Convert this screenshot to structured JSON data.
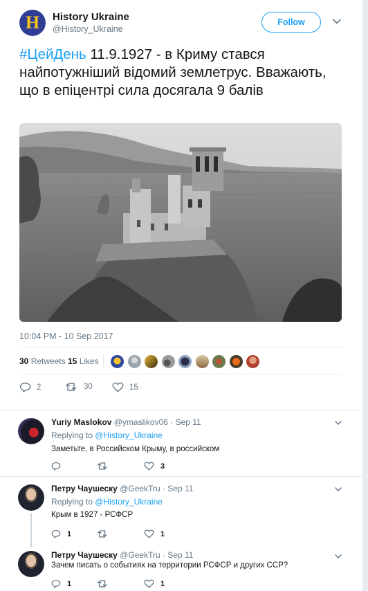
{
  "author": {
    "avatar_letter": "H",
    "name": "History Ukraine",
    "handle": "@History_Ukraine"
  },
  "follow_label": "Follow",
  "tweet": {
    "hashtag": "#ЦейДень",
    "text": " 11.9.1927 - в Криму стався найпотужніший відомий землетрус. Вважають, що в епіцентрі сила досягала 9 балів",
    "timestamp": "10:04 PM - 10 Sep 2017"
  },
  "stats": {
    "retweets_count": "30",
    "retweets_label": "Retweets",
    "likes_count": "15",
    "likes_label": "Likes"
  },
  "actions": {
    "reply_count": "2",
    "retweet_count": "30",
    "like_count": "15"
  },
  "replies": [
    {
      "name": "Yuriy Maslokov",
      "meta": "@ymaslikov06 · Sep 11",
      "replying_prefix": "Replying to ",
      "replying_to": "@History_Ukraine",
      "text": "Заметьте, в Российском Крыму, в российском",
      "reply_count": "",
      "retweet_count": "",
      "like_count": "3"
    },
    {
      "name": "Петру Чаушеску",
      "meta": "@GeekTru · Sep 11",
      "replying_prefix": "Replying to ",
      "replying_to": "@History_Ukraine",
      "text": "Крым в 1927 - РСФСР",
      "reply_count": "1",
      "retweet_count": "",
      "like_count": "1"
    },
    {
      "name": "Петру Чаушеску",
      "meta": "@GeekTru · Sep 11",
      "text": "Зачем писать о событиях на территории РСФСР и других ССР?",
      "reply_count": "1",
      "retweet_count": "",
      "like_count": "1"
    }
  ],
  "colors": {
    "accent": "#1da1f2",
    "secondary_text": "#657786",
    "brand_avatar_bg": "#2f3f95",
    "brand_avatar_letter": "#f5c518"
  }
}
